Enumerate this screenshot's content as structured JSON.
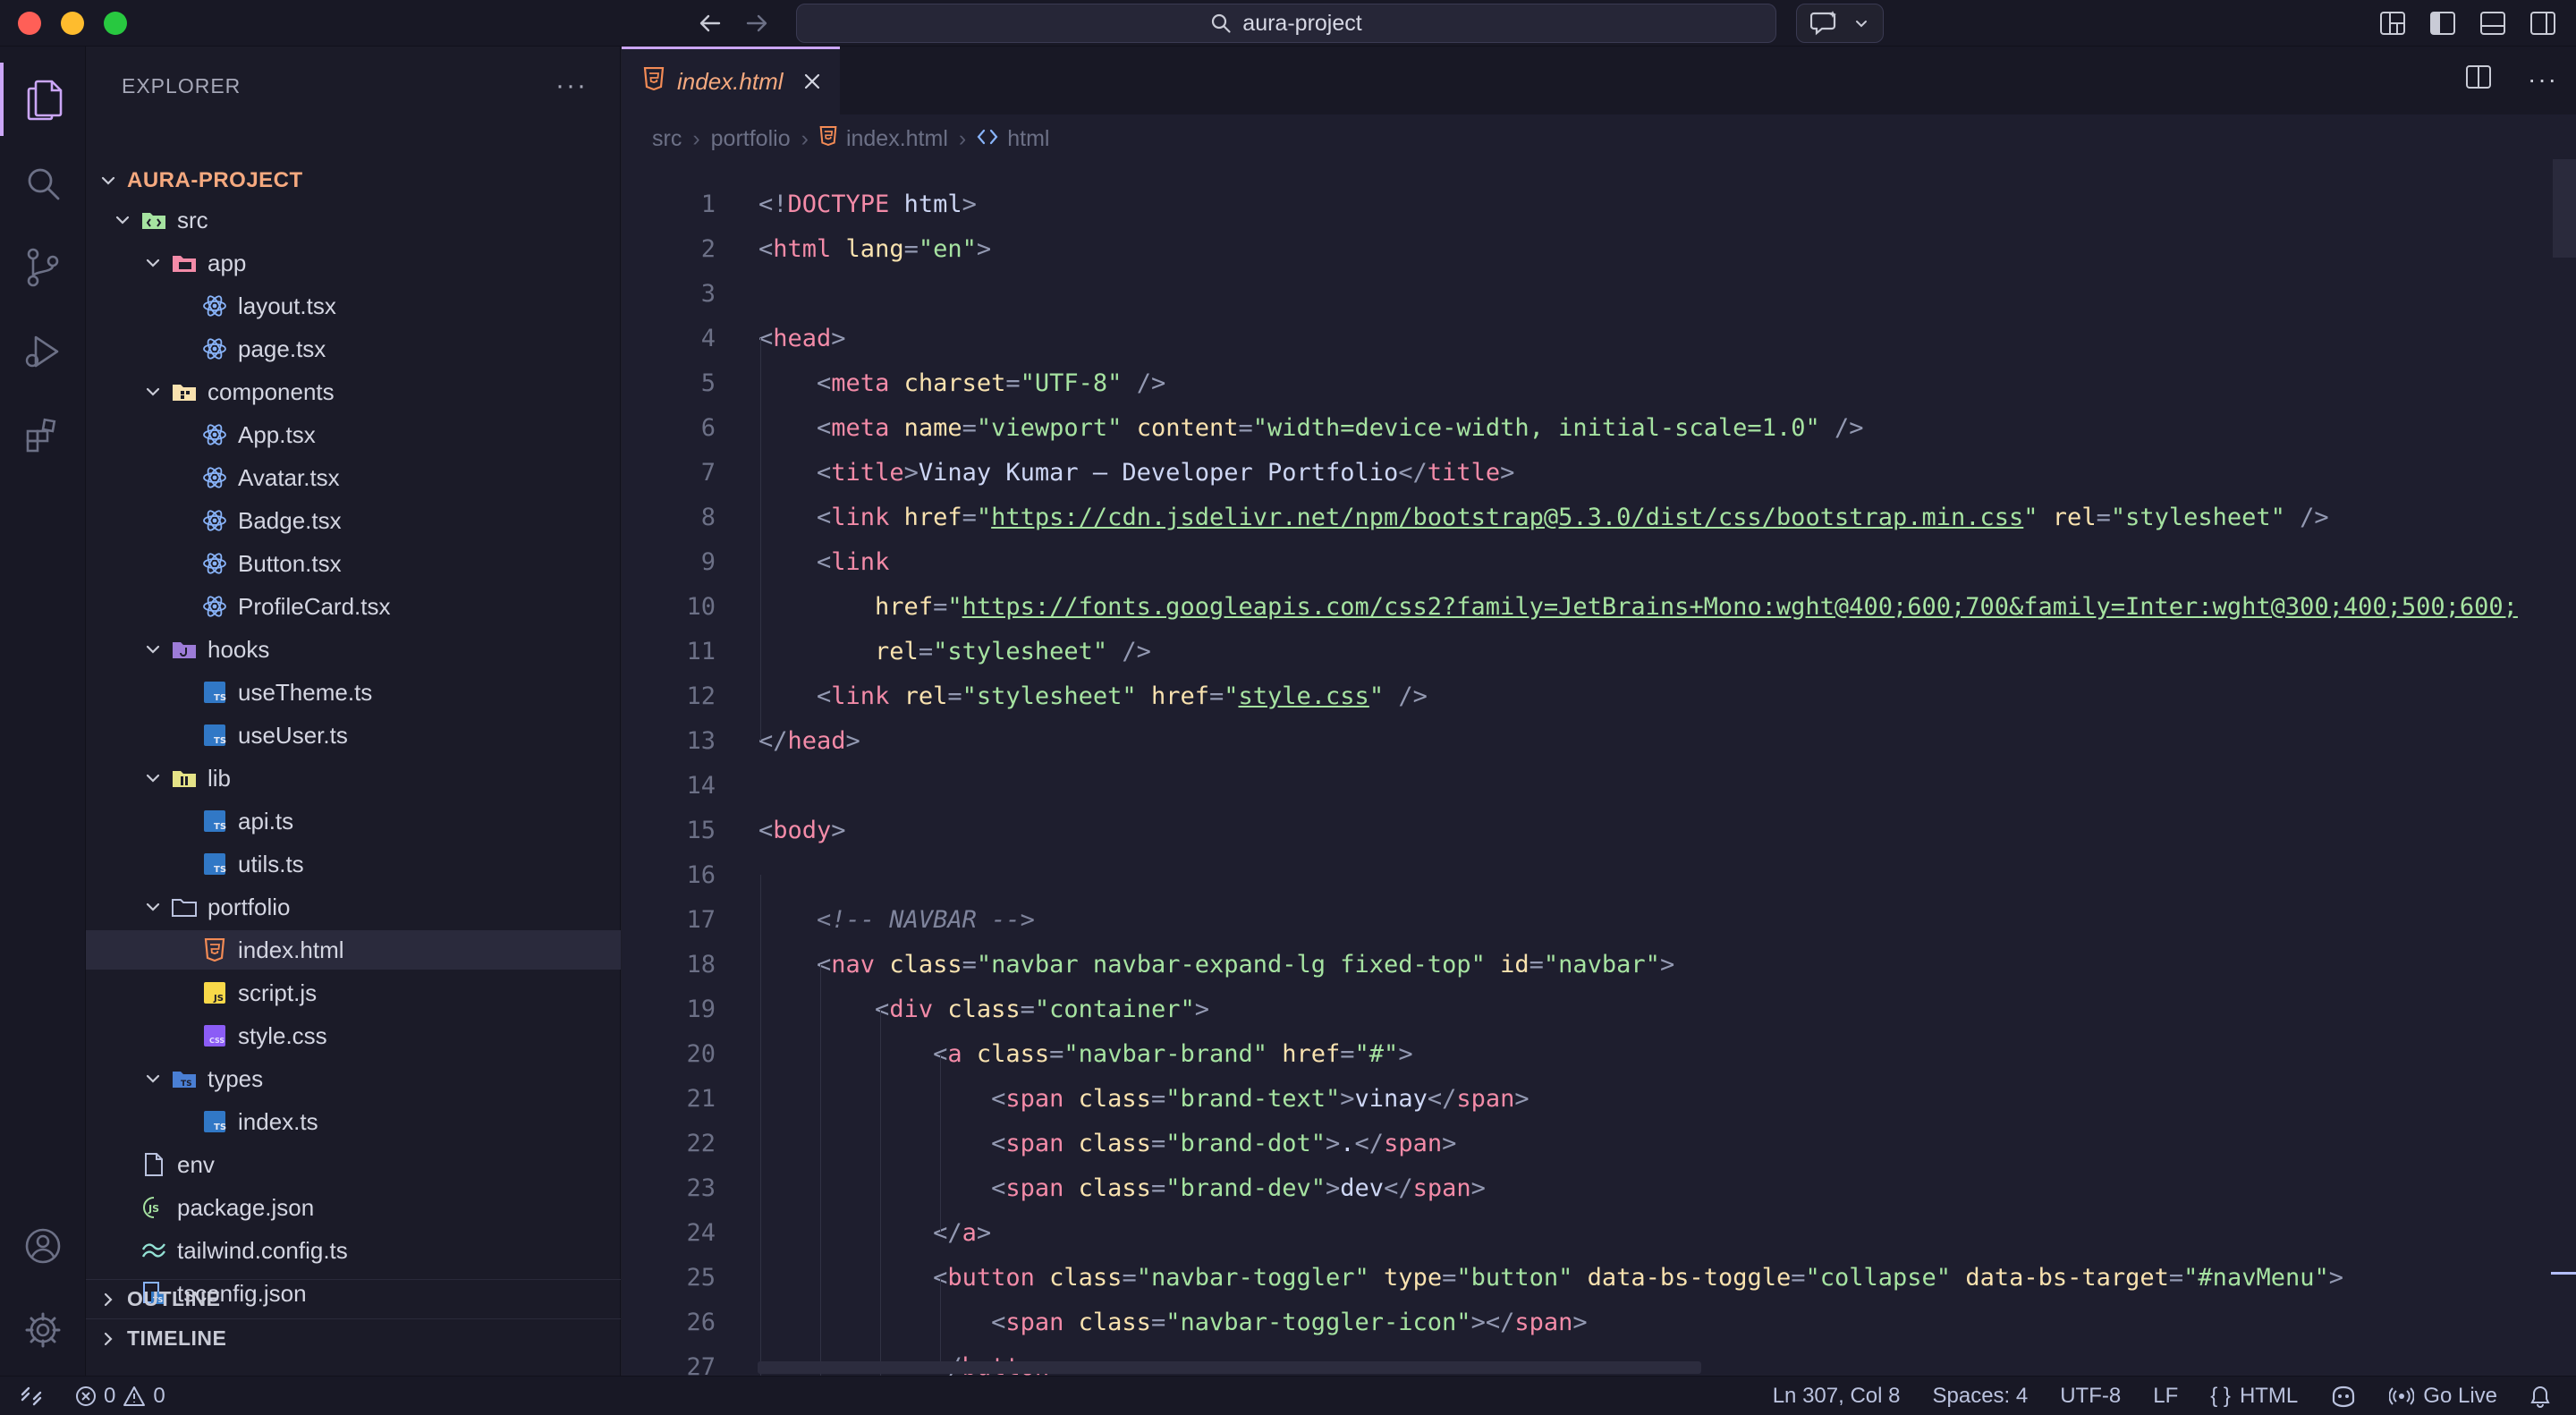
{
  "window": {
    "search": "aura-project"
  },
  "sidebar": {
    "title": "EXPLORER",
    "root": "AURA-PROJECT",
    "tree": [
      {
        "label": "src",
        "depth": 0,
        "kind": "folder-src",
        "expanded": true
      },
      {
        "label": "app",
        "depth": 1,
        "kind": "folder-app",
        "expanded": true
      },
      {
        "label": "layout.tsx",
        "depth": 2,
        "kind": "react"
      },
      {
        "label": "page.tsx",
        "depth": 2,
        "kind": "react"
      },
      {
        "label": "components",
        "depth": 1,
        "kind": "folder-components",
        "expanded": true
      },
      {
        "label": "App.tsx",
        "depth": 2,
        "kind": "react"
      },
      {
        "label": "Avatar.tsx",
        "depth": 2,
        "kind": "react"
      },
      {
        "label": "Badge.tsx",
        "depth": 2,
        "kind": "react"
      },
      {
        "label": "Button.tsx",
        "depth": 2,
        "kind": "react"
      },
      {
        "label": "ProfileCard.tsx",
        "depth": 2,
        "kind": "react"
      },
      {
        "label": "hooks",
        "depth": 1,
        "kind": "folder-hooks",
        "expanded": true
      },
      {
        "label": "useTheme.ts",
        "depth": 2,
        "kind": "ts"
      },
      {
        "label": "useUser.ts",
        "depth": 2,
        "kind": "ts"
      },
      {
        "label": "lib",
        "depth": 1,
        "kind": "folder-lib",
        "expanded": true
      },
      {
        "label": "api.ts",
        "depth": 2,
        "kind": "ts"
      },
      {
        "label": "utils.ts",
        "depth": 2,
        "kind": "ts"
      },
      {
        "label": "portfolio",
        "depth": 1,
        "kind": "folder-plain",
        "expanded": true
      },
      {
        "label": "index.html",
        "depth": 2,
        "kind": "html",
        "selected": true
      },
      {
        "label": "script.js",
        "depth": 2,
        "kind": "js"
      },
      {
        "label": "style.css",
        "depth": 2,
        "kind": "css"
      },
      {
        "label": "types",
        "depth": 1,
        "kind": "folder-types",
        "expanded": true
      },
      {
        "label": "index.ts",
        "depth": 2,
        "kind": "ts"
      },
      {
        "label": "env",
        "depth": 0,
        "kind": "file"
      },
      {
        "label": "package.json",
        "depth": 0,
        "kind": "json"
      },
      {
        "label": "tailwind.config.ts",
        "depth": 0,
        "kind": "tailwind"
      },
      {
        "label": "tsconfig.json",
        "depth": 0,
        "kind": "tsconfig"
      }
    ],
    "outline": "OUTLINE",
    "timeline": "TIMELINE"
  },
  "editor": {
    "tab_label": "index.html",
    "breadcrumb": [
      "src",
      "portfolio",
      "index.html",
      "html"
    ],
    "lines": [
      [
        [
          "b",
          "<!"
        ],
        [
          "t",
          "DOCTYPE"
        ],
        [
          "x",
          " html"
        ],
        [
          "b",
          ">"
        ]
      ],
      [
        [
          "b",
          "<"
        ],
        [
          "t",
          "html"
        ],
        [
          "a",
          " lang"
        ],
        [
          "b",
          "="
        ],
        [
          "s",
          "\"en\""
        ],
        [
          "b",
          ">"
        ]
      ],
      [],
      [
        [
          "b",
          "<"
        ],
        [
          "t",
          "head"
        ],
        [
          "b",
          ">"
        ]
      ],
      [
        [
          "x",
          "    "
        ],
        [
          "b",
          "<"
        ],
        [
          "t",
          "meta"
        ],
        [
          "a",
          " charset"
        ],
        [
          "b",
          "="
        ],
        [
          "s",
          "\"UTF-8\""
        ],
        [
          "b",
          " />"
        ]
      ],
      [
        [
          "x",
          "    "
        ],
        [
          "b",
          "<"
        ],
        [
          "t",
          "meta"
        ],
        [
          "a",
          " name"
        ],
        [
          "b",
          "="
        ],
        [
          "s",
          "\"viewport\""
        ],
        [
          "a",
          " content"
        ],
        [
          "b",
          "="
        ],
        [
          "s",
          "\"width=device-width, initial-scale=1.0\""
        ],
        [
          "b",
          " />"
        ]
      ],
      [
        [
          "x",
          "    "
        ],
        [
          "b",
          "<"
        ],
        [
          "t",
          "title"
        ],
        [
          "b",
          ">"
        ],
        [
          "x",
          "Vinay Kumar — Developer Portfolio"
        ],
        [
          "b",
          "</"
        ],
        [
          "t",
          "title"
        ],
        [
          "b",
          ">"
        ]
      ],
      [
        [
          "x",
          "    "
        ],
        [
          "b",
          "<"
        ],
        [
          "t",
          "link"
        ],
        [
          "a",
          " href"
        ],
        [
          "b",
          "="
        ],
        [
          "s",
          "\""
        ],
        [
          "u",
          "https://cdn.jsdelivr.net/npm/bootstrap@5.3.0/dist/css/bootstrap.min.css"
        ],
        [
          "s",
          "\""
        ],
        [
          "a",
          " rel"
        ],
        [
          "b",
          "="
        ],
        [
          "s",
          "\"stylesheet\""
        ],
        [
          "b",
          " />"
        ]
      ],
      [
        [
          "x",
          "    "
        ],
        [
          "b",
          "<"
        ],
        [
          "t",
          "link"
        ]
      ],
      [
        [
          "x",
          "        "
        ],
        [
          "a",
          "href"
        ],
        [
          "b",
          "="
        ],
        [
          "s",
          "\""
        ],
        [
          "u",
          "https://fonts.googleapis.com/css2?family=JetBrains+Mono:wght@400;600;700&family=Inter:wght@300;400;500;600;"
        ]
      ],
      [
        [
          "x",
          "        "
        ],
        [
          "a",
          "rel"
        ],
        [
          "b",
          "="
        ],
        [
          "s",
          "\"stylesheet\""
        ],
        [
          "b",
          " />"
        ]
      ],
      [
        [
          "x",
          "    "
        ],
        [
          "b",
          "<"
        ],
        [
          "t",
          "link"
        ],
        [
          "a",
          " rel"
        ],
        [
          "b",
          "="
        ],
        [
          "s",
          "\"stylesheet\""
        ],
        [
          "a",
          " href"
        ],
        [
          "b",
          "="
        ],
        [
          "s",
          "\""
        ],
        [
          "u",
          "style.css"
        ],
        [
          "s",
          "\""
        ],
        [
          "b",
          " />"
        ]
      ],
      [
        [
          "b",
          "</"
        ],
        [
          "t",
          "head"
        ],
        [
          "b",
          ">"
        ]
      ],
      [],
      [
        [
          "b",
          "<"
        ],
        [
          "t",
          "body"
        ],
        [
          "b",
          ">"
        ]
      ],
      [],
      [
        [
          "x",
          "    "
        ],
        [
          "c",
          "<!-- NAVBAR -->"
        ]
      ],
      [
        [
          "x",
          "    "
        ],
        [
          "b",
          "<"
        ],
        [
          "t",
          "nav"
        ],
        [
          "a",
          " class"
        ],
        [
          "b",
          "="
        ],
        [
          "s",
          "\"navbar navbar-expand-lg fixed-top\""
        ],
        [
          "a",
          " id"
        ],
        [
          "b",
          "="
        ],
        [
          "s",
          "\"navbar\""
        ],
        [
          "b",
          ">"
        ]
      ],
      [
        [
          "x",
          "        "
        ],
        [
          "b",
          "<"
        ],
        [
          "t",
          "div"
        ],
        [
          "a",
          " class"
        ],
        [
          "b",
          "="
        ],
        [
          "s",
          "\"container\""
        ],
        [
          "b",
          ">"
        ]
      ],
      [
        [
          "x",
          "            "
        ],
        [
          "b",
          "<"
        ],
        [
          "t",
          "a"
        ],
        [
          "a",
          " class"
        ],
        [
          "b",
          "="
        ],
        [
          "s",
          "\"navbar-brand\""
        ],
        [
          "a",
          " href"
        ],
        [
          "b",
          "="
        ],
        [
          "s",
          "\"#\""
        ],
        [
          "b",
          ">"
        ]
      ],
      [
        [
          "x",
          "                "
        ],
        [
          "b",
          "<"
        ],
        [
          "t",
          "span"
        ],
        [
          "a",
          " class"
        ],
        [
          "b",
          "="
        ],
        [
          "s",
          "\"brand-text\""
        ],
        [
          "b",
          ">"
        ],
        [
          "x",
          "vinay"
        ],
        [
          "b",
          "</"
        ],
        [
          "t",
          "span"
        ],
        [
          "b",
          ">"
        ]
      ],
      [
        [
          "x",
          "                "
        ],
        [
          "b",
          "<"
        ],
        [
          "t",
          "span"
        ],
        [
          "a",
          " class"
        ],
        [
          "b",
          "="
        ],
        [
          "s",
          "\"brand-dot\""
        ],
        [
          "b",
          ">"
        ],
        [
          "x",
          "."
        ],
        [
          "b",
          "</"
        ],
        [
          "t",
          "span"
        ],
        [
          "b",
          ">"
        ]
      ],
      [
        [
          "x",
          "                "
        ],
        [
          "b",
          "<"
        ],
        [
          "t",
          "span"
        ],
        [
          "a",
          " class"
        ],
        [
          "b",
          "="
        ],
        [
          "s",
          "\"brand-dev\""
        ],
        [
          "b",
          ">"
        ],
        [
          "x",
          "dev"
        ],
        [
          "b",
          "</"
        ],
        [
          "t",
          "span"
        ],
        [
          "b",
          ">"
        ]
      ],
      [
        [
          "x",
          "            "
        ],
        [
          "b",
          "</"
        ],
        [
          "t",
          "a"
        ],
        [
          "b",
          ">"
        ]
      ],
      [
        [
          "x",
          "            "
        ],
        [
          "b",
          "<"
        ],
        [
          "t",
          "button"
        ],
        [
          "a",
          " class"
        ],
        [
          "b",
          "="
        ],
        [
          "s",
          "\"navbar-toggler\""
        ],
        [
          "a",
          " type"
        ],
        [
          "b",
          "="
        ],
        [
          "s",
          "\"button\""
        ],
        [
          "a",
          " data-bs-toggle"
        ],
        [
          "b",
          "="
        ],
        [
          "s",
          "\"collapse\""
        ],
        [
          "a",
          " data-bs-target"
        ],
        [
          "b",
          "="
        ],
        [
          "s",
          "\"#navMenu\""
        ],
        [
          "b",
          ">"
        ]
      ],
      [
        [
          "x",
          "                "
        ],
        [
          "b",
          "<"
        ],
        [
          "t",
          "span"
        ],
        [
          "a",
          " class"
        ],
        [
          "b",
          "="
        ],
        [
          "s",
          "\"navbar-toggler-icon\""
        ],
        [
          "b",
          "></"
        ],
        [
          "t",
          "span"
        ],
        [
          "b",
          ">"
        ]
      ],
      [
        [
          "x",
          "            "
        ],
        [
          "b",
          "</"
        ],
        [
          "t",
          "button"
        ],
        [
          "b",
          ">"
        ]
      ]
    ]
  },
  "status": {
    "errors": "0",
    "warnings": "0",
    "position": "Ln 307, Col 8",
    "spaces": "Spaces: 4",
    "encoding": "UTF-8",
    "eol": "LF",
    "language": "HTML",
    "golive": "Go Live"
  },
  "colors": {
    "accent": "#cba6f7",
    "tag": "#f38ba8",
    "attr": "#f9e2af",
    "string": "#a6e3a1",
    "comment": "#7f849c"
  }
}
